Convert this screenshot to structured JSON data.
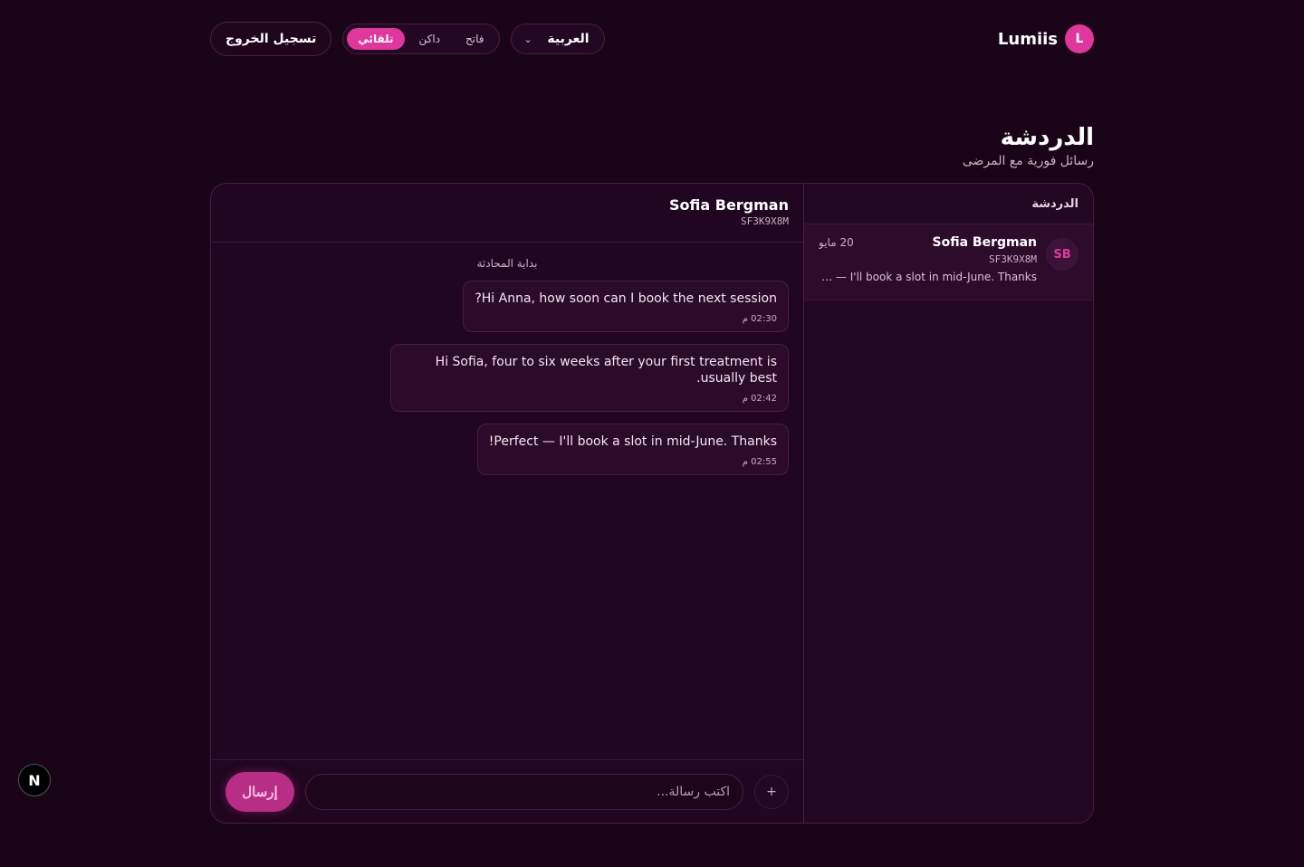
{
  "brand": {
    "name": "Lumiis",
    "avatar_initial": "L"
  },
  "header": {
    "language": "العربية",
    "theme_options": [
      "فاتح",
      "داكن",
      "تلقائي"
    ],
    "theme_active": "تلقائي",
    "logout_label": "تسجيل الخروج"
  },
  "page": {
    "title": "الدردشة",
    "subtitle": "رسائل فورية مع المرضى"
  },
  "sidebar": {
    "title": "الدردشة",
    "conversations": [
      {
        "initials": "SB",
        "name": "Sofia Bergman",
        "code": "SF3K9X8M",
        "date": "20 مايو",
        "preview": "Perfect — I'll book a slot in mid-June. Thanks!"
      }
    ]
  },
  "thread": {
    "name": "Sofia Bergman",
    "code": "SF3K9X8M",
    "start_label": "بداية المحادثة",
    "messages": [
      {
        "text": "Hi Anna, how soon can I book the next session?",
        "time": "02:30 م"
      },
      {
        "text": "Hi Sofia, four to six weeks after your first treatment is usually best.",
        "time": "02:42 م"
      },
      {
        "text": "Perfect — I'll book a slot in mid-June. Thanks!",
        "time": "02:55 م"
      }
    ]
  },
  "composer": {
    "placeholder": "اكتب رسالة...",
    "send_label": "إرسال",
    "attach_glyph": "+"
  },
  "next_badge": "N",
  "colors": {
    "accent": "#e0379e",
    "background": "#1a0518",
    "panel": "#200620",
    "border": "#4a1d44"
  }
}
